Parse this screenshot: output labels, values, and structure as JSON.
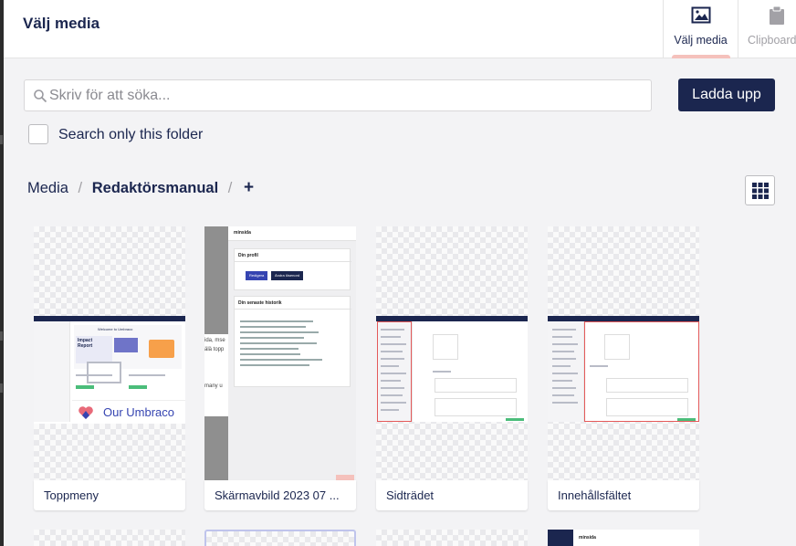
{
  "dialog": {
    "title": "Välj media",
    "tabs": [
      {
        "label": "Välj media",
        "icon": "image-icon",
        "active": true
      },
      {
        "label": "Clipboard",
        "icon": "clipboard-icon",
        "active": false
      }
    ]
  },
  "search": {
    "placeholder": "Skriv för att söka...",
    "value": ""
  },
  "upload_label": "Ladda upp",
  "search_only_folder": {
    "label": "Search only this folder",
    "checked": false
  },
  "breadcrumb": {
    "items": [
      "Media",
      "Redaktörsmanual"
    ],
    "separator": "/",
    "add": "+"
  },
  "view_toggle_icon": "grid-icon",
  "media_items": [
    {
      "name": "Toppmeny",
      "logo_text": "Our Umbraco"
    },
    {
      "name": "Skärmavbild 2023 07 ..."
    },
    {
      "name": "Sidträdet"
    },
    {
      "name": "Innehållsfältet"
    }
  ],
  "thumbnail_text": {
    "brand": "minsida",
    "profile_heading": "Din profil",
    "profile_button_primary": "Redigera",
    "profile_button_secondary": "Ändra lösenord",
    "history_heading": "Din senaste historik",
    "partial_text_1": "ida, mse",
    "partial_text_2": "älä topp",
    "partial_text_3": "many u",
    "welcome": "Welcome to Umbraco",
    "impact": "Impact Report"
  },
  "colors": {
    "navy": "#1b264f",
    "panel_bg": "#f3f3f5",
    "tab_indicator": "#f5c1bc",
    "thumb_highlight": "#e45a5a"
  }
}
